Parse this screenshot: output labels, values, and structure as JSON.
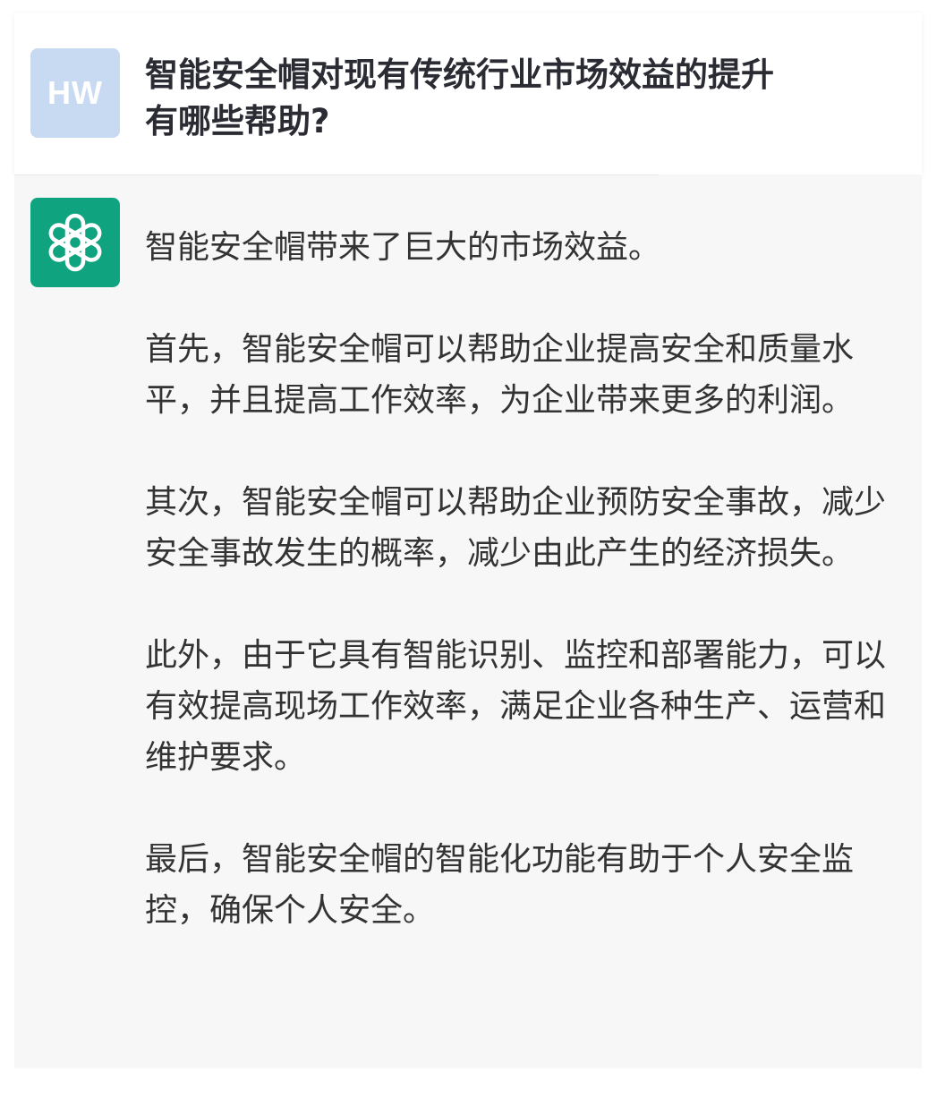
{
  "user": {
    "avatar_initials": "HW",
    "question_line1": "智能安全帽对现有传统行业市场效益的提升",
    "question_line2": "有哪些帮助?"
  },
  "assistant": {
    "avatar_icon": "openai-logo-icon",
    "paragraphs": [
      "智能安全帽带来了巨大的市场效益。",
      "首先，智能安全帽可以帮助企业提高安全和质量水平，并且提高工作效率，为企业带来更多的利润。",
      "其次，智能安全帽可以帮助企业预防安全事故，减少安全事故发生的概率，减少由此产生的经济损失。",
      "此外，由于它具有智能识别、监控和部署能力，可以有效提高现场工作效率，满足企业各种生产、运营和维护要求。",
      "最后，智能安全帽的智能化功能有助于个人安全监控，确保个人安全。"
    ]
  },
  "colors": {
    "user_avatar_bg": "#c8d9f2",
    "assistant_avatar_bg": "#10a37f",
    "assistant_row_bg": "#f7f7f8",
    "text": "#333333"
  }
}
